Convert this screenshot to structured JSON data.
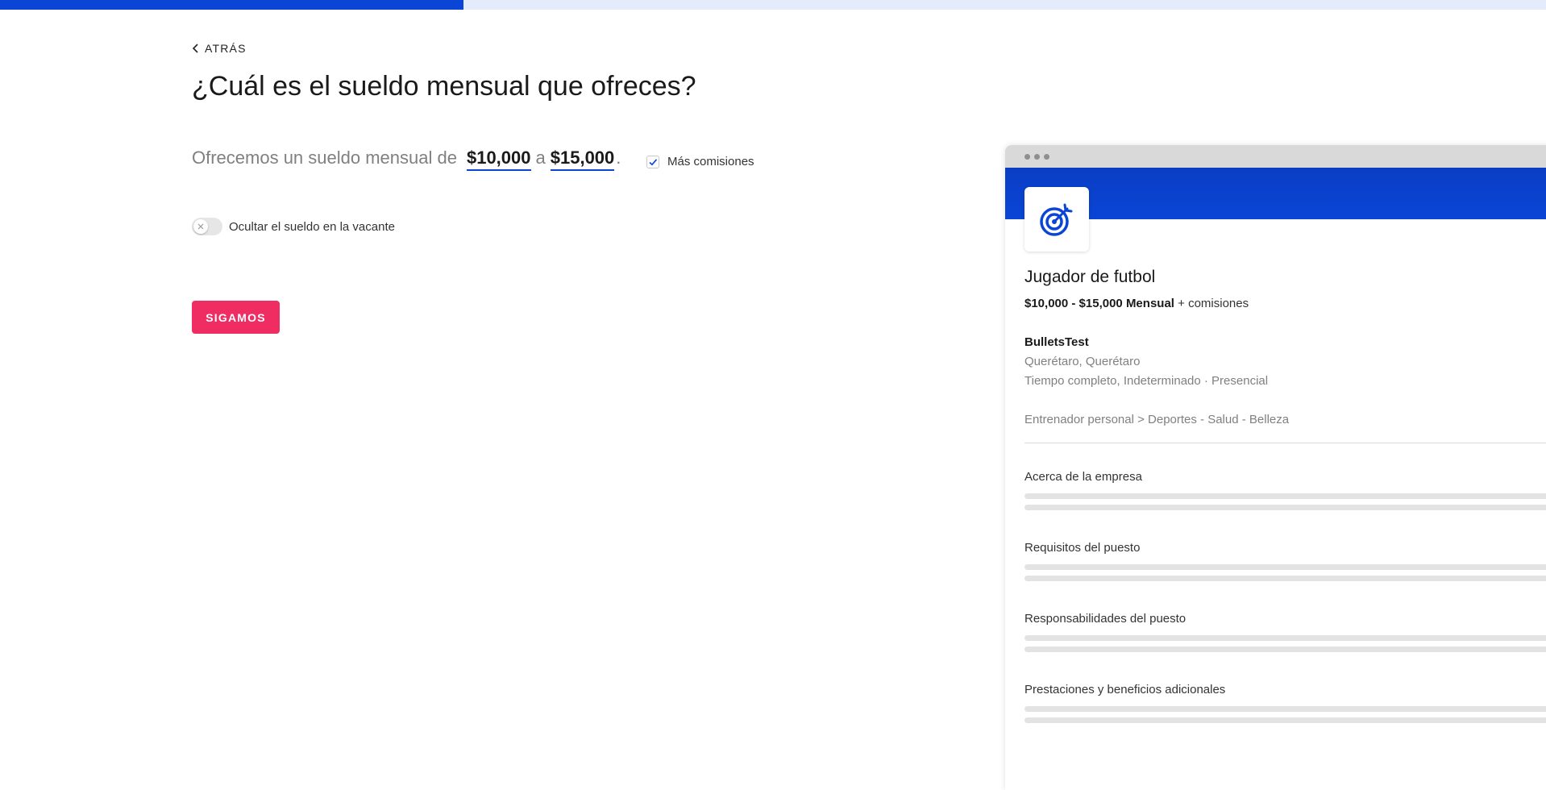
{
  "progress": {
    "fraction": 0.3
  },
  "nav": {
    "back_label": "ATRÁS"
  },
  "page": {
    "title": "¿Cuál es el sueldo mensual que ofreces?"
  },
  "salary": {
    "prefix": "Ofrecemos un sueldo mensual de",
    "min": "$10,000",
    "connector": "a",
    "max": "$15,000",
    "suffix": "."
  },
  "commission": {
    "label": "Más comisiones",
    "checked": true
  },
  "hide_salary": {
    "label": "Ocultar el sueldo en la vacante",
    "enabled": false
  },
  "submit": {
    "label": "SIGAMOS"
  },
  "colors": {
    "primary": "#0a45d6",
    "accent": "#ef2d63",
    "muted": "#808080"
  },
  "preview": {
    "logo_icon": "target-icon",
    "job_title": "Jugador de futbol",
    "salary_range": "$10,000 - $15,000 Mensual",
    "salary_extra": "+ comisiones",
    "company": "BulletsTest",
    "location": "Querétaro, Querétaro",
    "job_type": "Tiempo completo, Indeterminado · Presencial",
    "category": "Entrenador personal > Deportes - Salud - Belleza",
    "sections": [
      {
        "title": "Acerca de la empresa"
      },
      {
        "title": "Requisitos del puesto"
      },
      {
        "title": "Responsabilidades del puesto"
      },
      {
        "title": "Prestaciones y beneficios adicionales"
      }
    ]
  }
}
